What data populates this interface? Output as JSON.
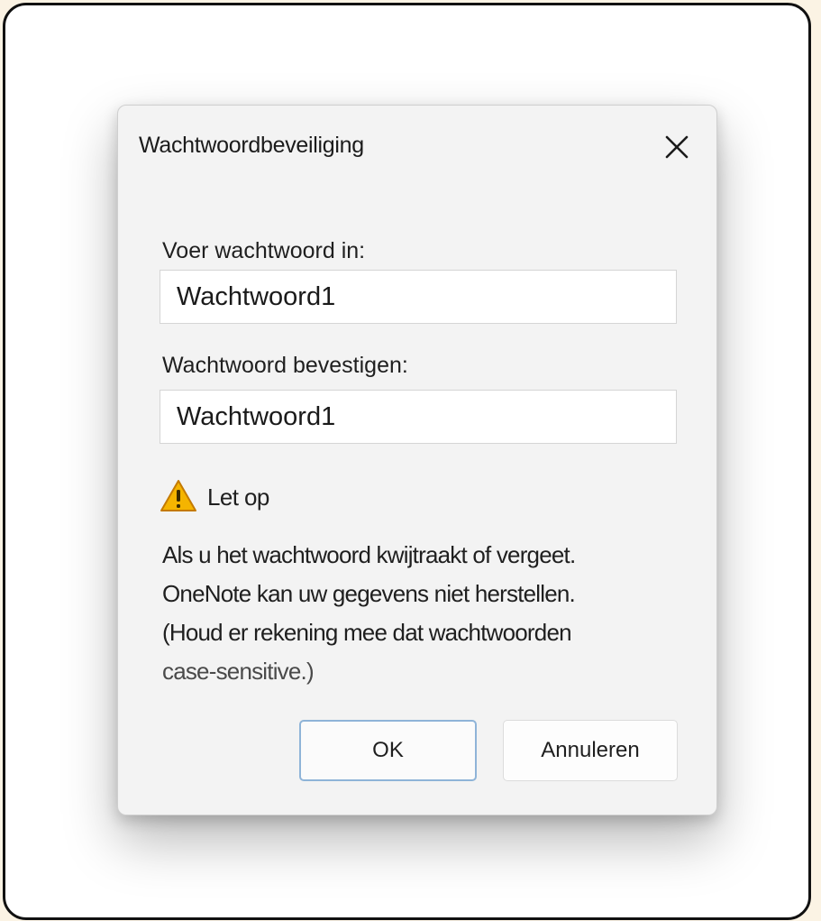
{
  "dialog": {
    "title": "Wachtwoordbeveiliging",
    "close_icon": "close-icon",
    "password_label": "Voer wachtwoord in:",
    "password_value": "Wachtwoord1",
    "confirm_label": "Wachtwoord bevestigen:",
    "confirm_value": "Wachtwoord1",
    "warning": {
      "icon": "warning-icon",
      "label": "Let op",
      "lines": [
        "Als u het wachtwoord kwijtraakt of vergeet.",
        "OneNote kan uw gegevens niet herstellen.",
        "(Houd er rekening mee dat wachtwoorden",
        "case-sensitive.)"
      ]
    },
    "buttons": {
      "ok": "OK",
      "cancel": "Annuleren"
    }
  },
  "colors": {
    "warning_fill": "#f5b400",
    "ok_border": "#8fb4d8",
    "background": "#fbf3e4"
  }
}
